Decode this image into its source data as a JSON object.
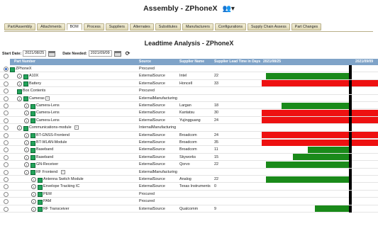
{
  "app": {
    "title": "Assembly - ZPhoneX",
    "title_icon": "user-add-icon"
  },
  "tabs": [
    {
      "label": "Part/Assembly",
      "active": false
    },
    {
      "label": "Attachments",
      "active": false
    },
    {
      "label": "BOM",
      "active": true
    },
    {
      "label": "Process",
      "active": false
    },
    {
      "label": "Suppliers",
      "active": false
    },
    {
      "label": "Alternates",
      "active": false
    },
    {
      "label": "Substitutes",
      "active": false
    },
    {
      "label": "Manufacturers",
      "active": false
    },
    {
      "label": "Configurations",
      "active": false
    },
    {
      "label": "Supply Chain Assess",
      "active": false
    },
    {
      "label": "Part Changes",
      "active": false
    }
  ],
  "page_title": "Leadtime Analysis - ZPhoneX",
  "dates": {
    "start_label": "Start Date:",
    "start_value": "2021/08/25",
    "needed_label": "Date Needed:",
    "needed_value": "2021/09/09"
  },
  "table": {
    "headers": {
      "part": "Part Number",
      "source": "Source",
      "supplier": "Supplier Name",
      "lead": "Supplier Lead Time in Days",
      "date_start": "2021/08/25",
      "date_end": "2021/09/09"
    },
    "rows": [
      {
        "indent": 0,
        "radio": true,
        "info": false,
        "expand": false,
        "part": "ZPhoneX",
        "source": "Procured",
        "supplier": "",
        "lead": "",
        "bar": null
      },
      {
        "indent": 1,
        "radio": false,
        "info": true,
        "expand": false,
        "part": "A10X",
        "source": "ExternalSource",
        "supplier": "Intel",
        "lead": "22",
        "bar": "green"
      },
      {
        "indent": 1,
        "radio": false,
        "info": true,
        "expand": false,
        "part": "Battery",
        "source": "ExternalSource",
        "supplier": "Honcell",
        "lead": "33",
        "bar": "red"
      },
      {
        "indent": 1,
        "radio": false,
        "info": false,
        "expand": false,
        "part": "Box Contents",
        "source": "Procured",
        "supplier": "",
        "lead": "",
        "bar": null
      },
      {
        "indent": 1,
        "radio": false,
        "info": true,
        "expand": true,
        "part": "Cameras",
        "source": "ExternalManufacturing",
        "supplier": "",
        "lead": "",
        "bar": null
      },
      {
        "indent": 2,
        "radio": false,
        "info": true,
        "expand": false,
        "part": "Camera-Lens",
        "source": "ExternalSource",
        "supplier": "Largan",
        "lead": "18",
        "bar": "green"
      },
      {
        "indent": 2,
        "radio": false,
        "info": true,
        "expand": false,
        "part": "Camera-Lens",
        "source": "ExternalSource",
        "supplier": "Kantatsu",
        "lead": "30",
        "bar": "red"
      },
      {
        "indent": 2,
        "radio": false,
        "info": true,
        "expand": false,
        "part": "Camera-Lens",
        "source": "ExternalSource",
        "supplier": "Yujingguang",
        "lead": "24",
        "bar": "red"
      },
      {
        "indent": 1,
        "radio": false,
        "info": true,
        "expand": true,
        "part": "Communications-module",
        "source": "InternalManufacturing",
        "supplier": "",
        "lead": "",
        "bar": null
      },
      {
        "indent": 2,
        "radio": false,
        "info": true,
        "expand": false,
        "part": "BT-GNSS-Frontend",
        "source": "ExternalSource",
        "supplier": "Broadcom",
        "lead": "24",
        "bar": "red"
      },
      {
        "indent": 2,
        "radio": false,
        "info": true,
        "expand": false,
        "part": "BT-WLAN-Module",
        "source": "ExternalSource",
        "supplier": "Broadcom",
        "lead": "35",
        "bar": "red"
      },
      {
        "indent": 2,
        "radio": false,
        "info": true,
        "expand": false,
        "part": "Baseband",
        "source": "ExternalSource",
        "supplier": "Broadcom",
        "lead": "11",
        "bar": "green"
      },
      {
        "indent": 2,
        "radio": false,
        "info": true,
        "expand": false,
        "part": "Baseband",
        "source": "ExternalSource",
        "supplier": "Skyworks",
        "lead": "15",
        "bar": "green"
      },
      {
        "indent": 2,
        "radio": false,
        "info": true,
        "expand": false,
        "part": "GN-Receiver",
        "source": "ExternalSource",
        "supplier": "Qorvo",
        "lead": "22",
        "bar": "green"
      },
      {
        "indent": 2,
        "radio": false,
        "info": true,
        "expand": true,
        "part": "RF Frontend",
        "source": "ExternalManufacturing",
        "supplier": "",
        "lead": "",
        "bar": null
      },
      {
        "indent": 3,
        "radio": false,
        "info": true,
        "expand": false,
        "part": "Antenna Switch Module",
        "source": "ExternalSource",
        "supplier": "Analog",
        "lead": "22",
        "bar": "green"
      },
      {
        "indent": 3,
        "radio": false,
        "info": true,
        "expand": false,
        "part": "Envelope Tracking IC",
        "source": "ExternalSource",
        "supplier": "Texas Instruments",
        "lead": "0",
        "bar": null
      },
      {
        "indent": 3,
        "radio": false,
        "info": true,
        "expand": false,
        "part": "PEM",
        "source": "Procured",
        "supplier": "",
        "lead": "",
        "bar": null
      },
      {
        "indent": 3,
        "radio": false,
        "info": true,
        "expand": false,
        "part": "PAM",
        "source": "Procured",
        "supplier": "",
        "lead": "",
        "bar": null
      },
      {
        "indent": 3,
        "radio": false,
        "info": true,
        "expand": false,
        "part": "RF Transceiver",
        "source": "ExternalSource",
        "supplier": "Qualcomm",
        "lead": "9",
        "bar": "green"
      }
    ]
  },
  "colors": {
    "header": "#7fa3c8",
    "green": "#1a8a1a",
    "red": "#ee1111",
    "marker": "#000000"
  }
}
